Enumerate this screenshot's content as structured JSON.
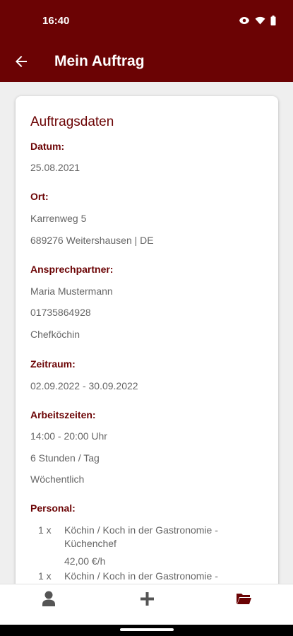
{
  "status": {
    "time": "16:40",
    "icons": [
      "eye-icon",
      "wifi-icon",
      "battery-icon"
    ]
  },
  "appbar": {
    "title": "Mein Auftrag",
    "back_icon": "arrow-back-icon"
  },
  "card": {
    "title": "Auftragsdaten",
    "datum_label": "Datum:",
    "datum": "25.08.2021",
    "ort_label": "Ort:",
    "ort_street": "Karrenweg 5",
    "ort_city": "689276 Weitershausen | DE",
    "contact_label": "Ansprechpartner:",
    "contact_name": "Maria Mustermann",
    "contact_phone": "01735864928",
    "contact_role": "Chefköchin",
    "zeitraum_label": "Zeitraum:",
    "zeitraum": "02.09.2022 - 30.09.2022",
    "arbeitszeiten_label": "Arbeitszeiten:",
    "arbeitszeiten_time": "14:00 - 20:00 Uhr",
    "arbeitszeiten_hours": "6 Stunden / Tag",
    "arbeitszeiten_freq": "Wöchentlich",
    "personal_label": "Personal:",
    "personal": [
      {
        "qty": "1 x",
        "role": "Köchin / Koch in der Gastronomie - Küchenchef",
        "rate": "42,00 €/h"
      },
      {
        "qty": "1 x",
        "role": "Köchin / Koch in der Gastronomie -"
      }
    ]
  },
  "bottomnav": {
    "items": [
      "person-icon",
      "plus-icon",
      "folder-icon"
    ]
  },
  "colors": {
    "brand": "#6b0304",
    "text_muted": "#666666",
    "background": "#efefef"
  }
}
